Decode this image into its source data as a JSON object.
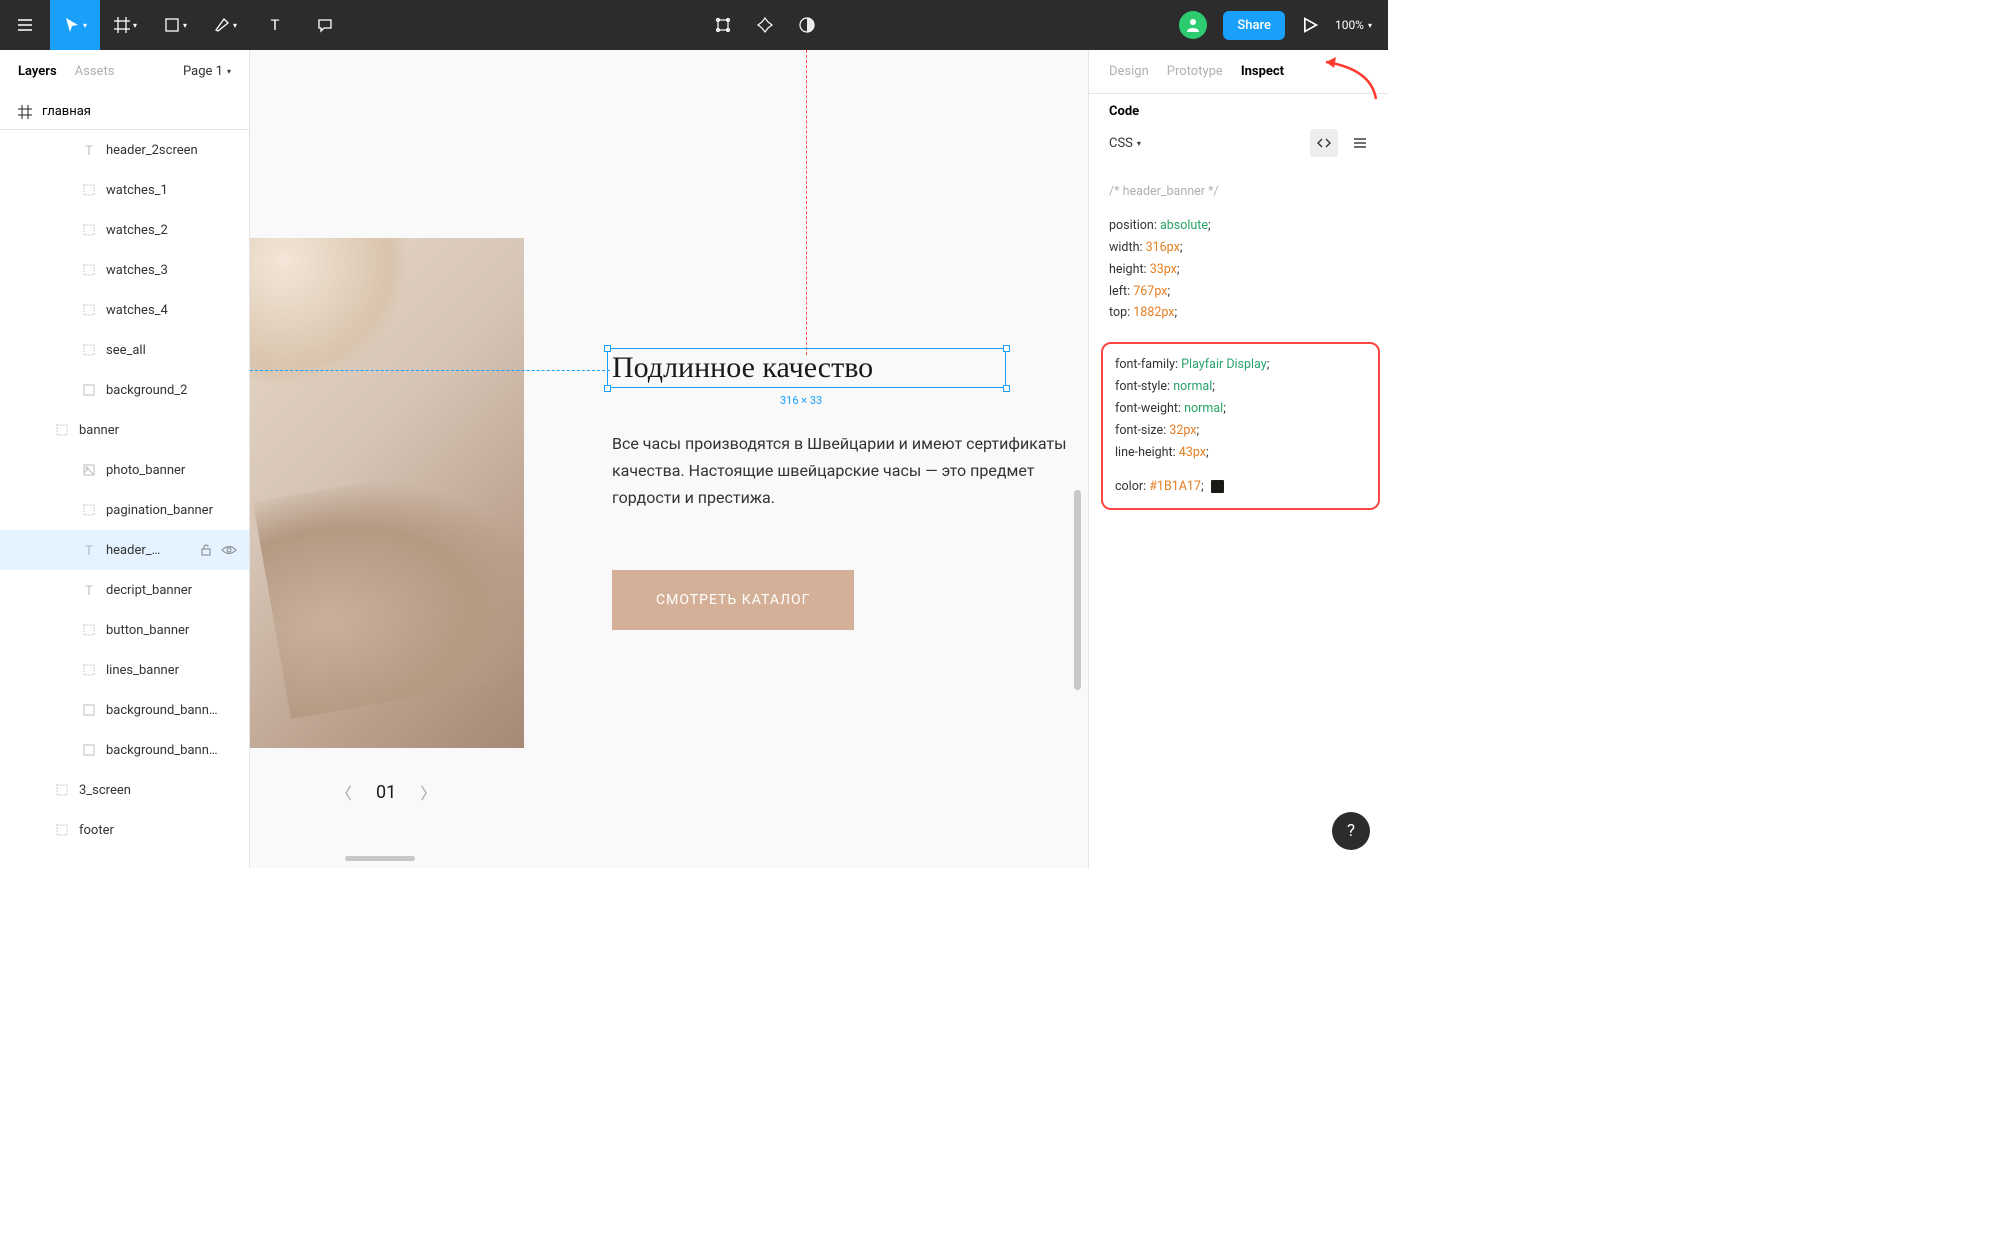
{
  "toolbar": {
    "share_label": "Share",
    "zoom_label": "100%"
  },
  "left": {
    "tab_layers": "Layers",
    "tab_assets": "Assets",
    "page_label": "Page 1",
    "frame_name": "главная",
    "layers": [
      {
        "icon": "text",
        "name": "header_2screen",
        "indent": 82
      },
      {
        "icon": "frame",
        "name": "watches_1",
        "indent": 82
      },
      {
        "icon": "frame",
        "name": "watches_2",
        "indent": 82
      },
      {
        "icon": "frame",
        "name": "watches_3",
        "indent": 82
      },
      {
        "icon": "frame",
        "name": "watches_4",
        "indent": 82
      },
      {
        "icon": "frame",
        "name": "see_all",
        "indent": 82
      },
      {
        "icon": "rect",
        "name": "background_2",
        "indent": 82
      },
      {
        "icon": "frame",
        "name": "banner",
        "indent": 55
      },
      {
        "icon": "image",
        "name": "photo_banner",
        "indent": 82
      },
      {
        "icon": "frame",
        "name": "pagination_banner",
        "indent": 82
      },
      {
        "icon": "text",
        "name": "header_…",
        "indent": 82,
        "selected": true
      },
      {
        "icon": "text",
        "name": "decript_banner",
        "indent": 82
      },
      {
        "icon": "frame",
        "name": "button_banner",
        "indent": 82
      },
      {
        "icon": "frame",
        "name": "lines_banner",
        "indent": 82
      },
      {
        "icon": "rect",
        "name": "background_bann…",
        "indent": 82
      },
      {
        "icon": "rect",
        "name": "background_bann…",
        "indent": 82
      },
      {
        "icon": "frame",
        "name": "3_screen",
        "indent": 55
      },
      {
        "icon": "frame",
        "name": "footer",
        "indent": 55
      }
    ]
  },
  "canvas": {
    "heading": "Подлинное качество",
    "selection_size": "316 × 33",
    "paragraph": "Все часы производятся в Швейцарии и имеют сертификаты качества. Настоящие швейцарские часы — это предмет гордости и престижа.",
    "cta_label": "СМОТРЕТЬ КАТАЛОГ",
    "page_number": "01"
  },
  "right": {
    "tab_design": "Design",
    "tab_prototype": "Prototype",
    "tab_inspect": "Inspect",
    "section_code": "Code",
    "code_lang": "CSS",
    "code_comment": "/* header_banner */",
    "props_top": [
      {
        "k": "position",
        "v": "absolute",
        "cls": "val-green"
      },
      {
        "k": "width",
        "v": "316px",
        "cls": "val-orange"
      },
      {
        "k": "height",
        "v": "33px",
        "cls": "val-orange"
      },
      {
        "k": "left",
        "v": "767px",
        "cls": "val-orange"
      },
      {
        "k": "top",
        "v": "1882px",
        "cls": "val-orange"
      }
    ],
    "props_font": [
      {
        "k": "font-family",
        "v": "Playfair Display",
        "cls": "val-green"
      },
      {
        "k": "font-style",
        "v": "normal",
        "cls": "val-green"
      },
      {
        "k": "font-weight",
        "v": "normal",
        "cls": "val-green"
      },
      {
        "k": "font-size",
        "v": "32px",
        "cls": "val-orange"
      },
      {
        "k": "line-height",
        "v": "43px",
        "cls": "val-orange"
      }
    ],
    "color_key": "color",
    "color_value": "#1B1A17"
  },
  "help_label": "?"
}
